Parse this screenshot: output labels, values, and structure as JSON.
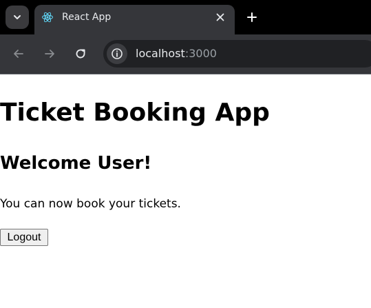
{
  "browser": {
    "tab": {
      "title": "React App",
      "favicon": "react-logo-icon"
    },
    "address_bar": {
      "host": "localhost",
      "port": ":3000"
    },
    "icons": {
      "tab_search": "chevron-down-icon",
      "close_tab": "close-icon",
      "new_tab": "plus-icon",
      "back": "arrow-left-icon",
      "forward": "arrow-right-icon",
      "reload": "reload-icon",
      "site_info": "info-icon"
    },
    "colors": {
      "tabstrip": "#000000",
      "toolbar": "#35363a",
      "omnibox": "#202124",
      "react_blue": "#61dafb"
    }
  },
  "page": {
    "title": "Ticket Booking App",
    "welcome": "Welcome User!",
    "message": "You can now book your tickets.",
    "logout_label": "Logout"
  }
}
